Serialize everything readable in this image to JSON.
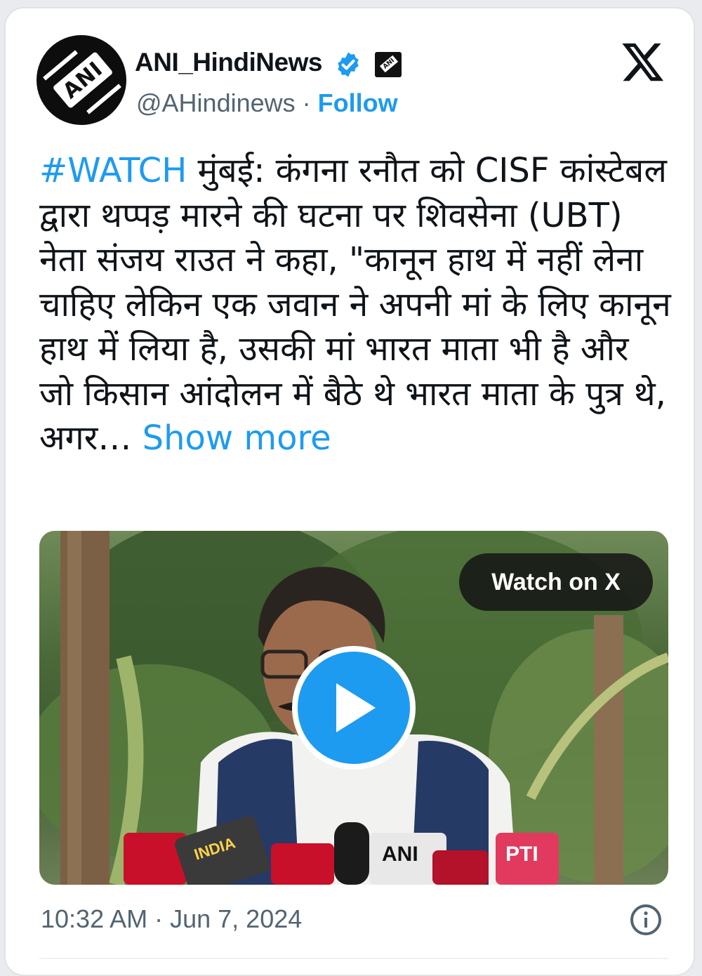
{
  "author": {
    "display_name": "ANI_HindiNews",
    "handle": "@AHindinews",
    "separator": "·",
    "follow_label": "Follow",
    "avatar_logo_text": "ANI"
  },
  "tweet": {
    "hashtag": "#WATCH",
    "body": " मुंबई: कंगना रनौत को CISF कांस्टेबल द्वारा थप्पड़ मारने की घटना पर शिवसेना (UBT) नेता संजय राउत ने कहा, \"कानून हाथ में नहीं लेना चाहिए लेकिन एक जवान ने अपनी मां के लिए कानून हाथ में लिया है, उसकी मां भारत माता भी है और जो किसान आंदोलन में बैठे थे भारत माता के पुत्र थे, अगर… ",
    "show_more_label": "Show more"
  },
  "media": {
    "watch_label": "Watch on X",
    "mic_labels": [
      "INDIA",
      "ANI",
      "PTI"
    ]
  },
  "footer": {
    "timestamp": "10:32 AM · Jun 7, 2024"
  },
  "colors": {
    "accent": "#1d9bf0",
    "text_primary": "#0f1419",
    "text_secondary": "#536471"
  },
  "icons": {
    "verified": "verified-badge-icon",
    "affiliation": "ani-affiliate-icon",
    "brand": "x-logo-icon",
    "play": "play-icon",
    "info": "info-icon"
  }
}
